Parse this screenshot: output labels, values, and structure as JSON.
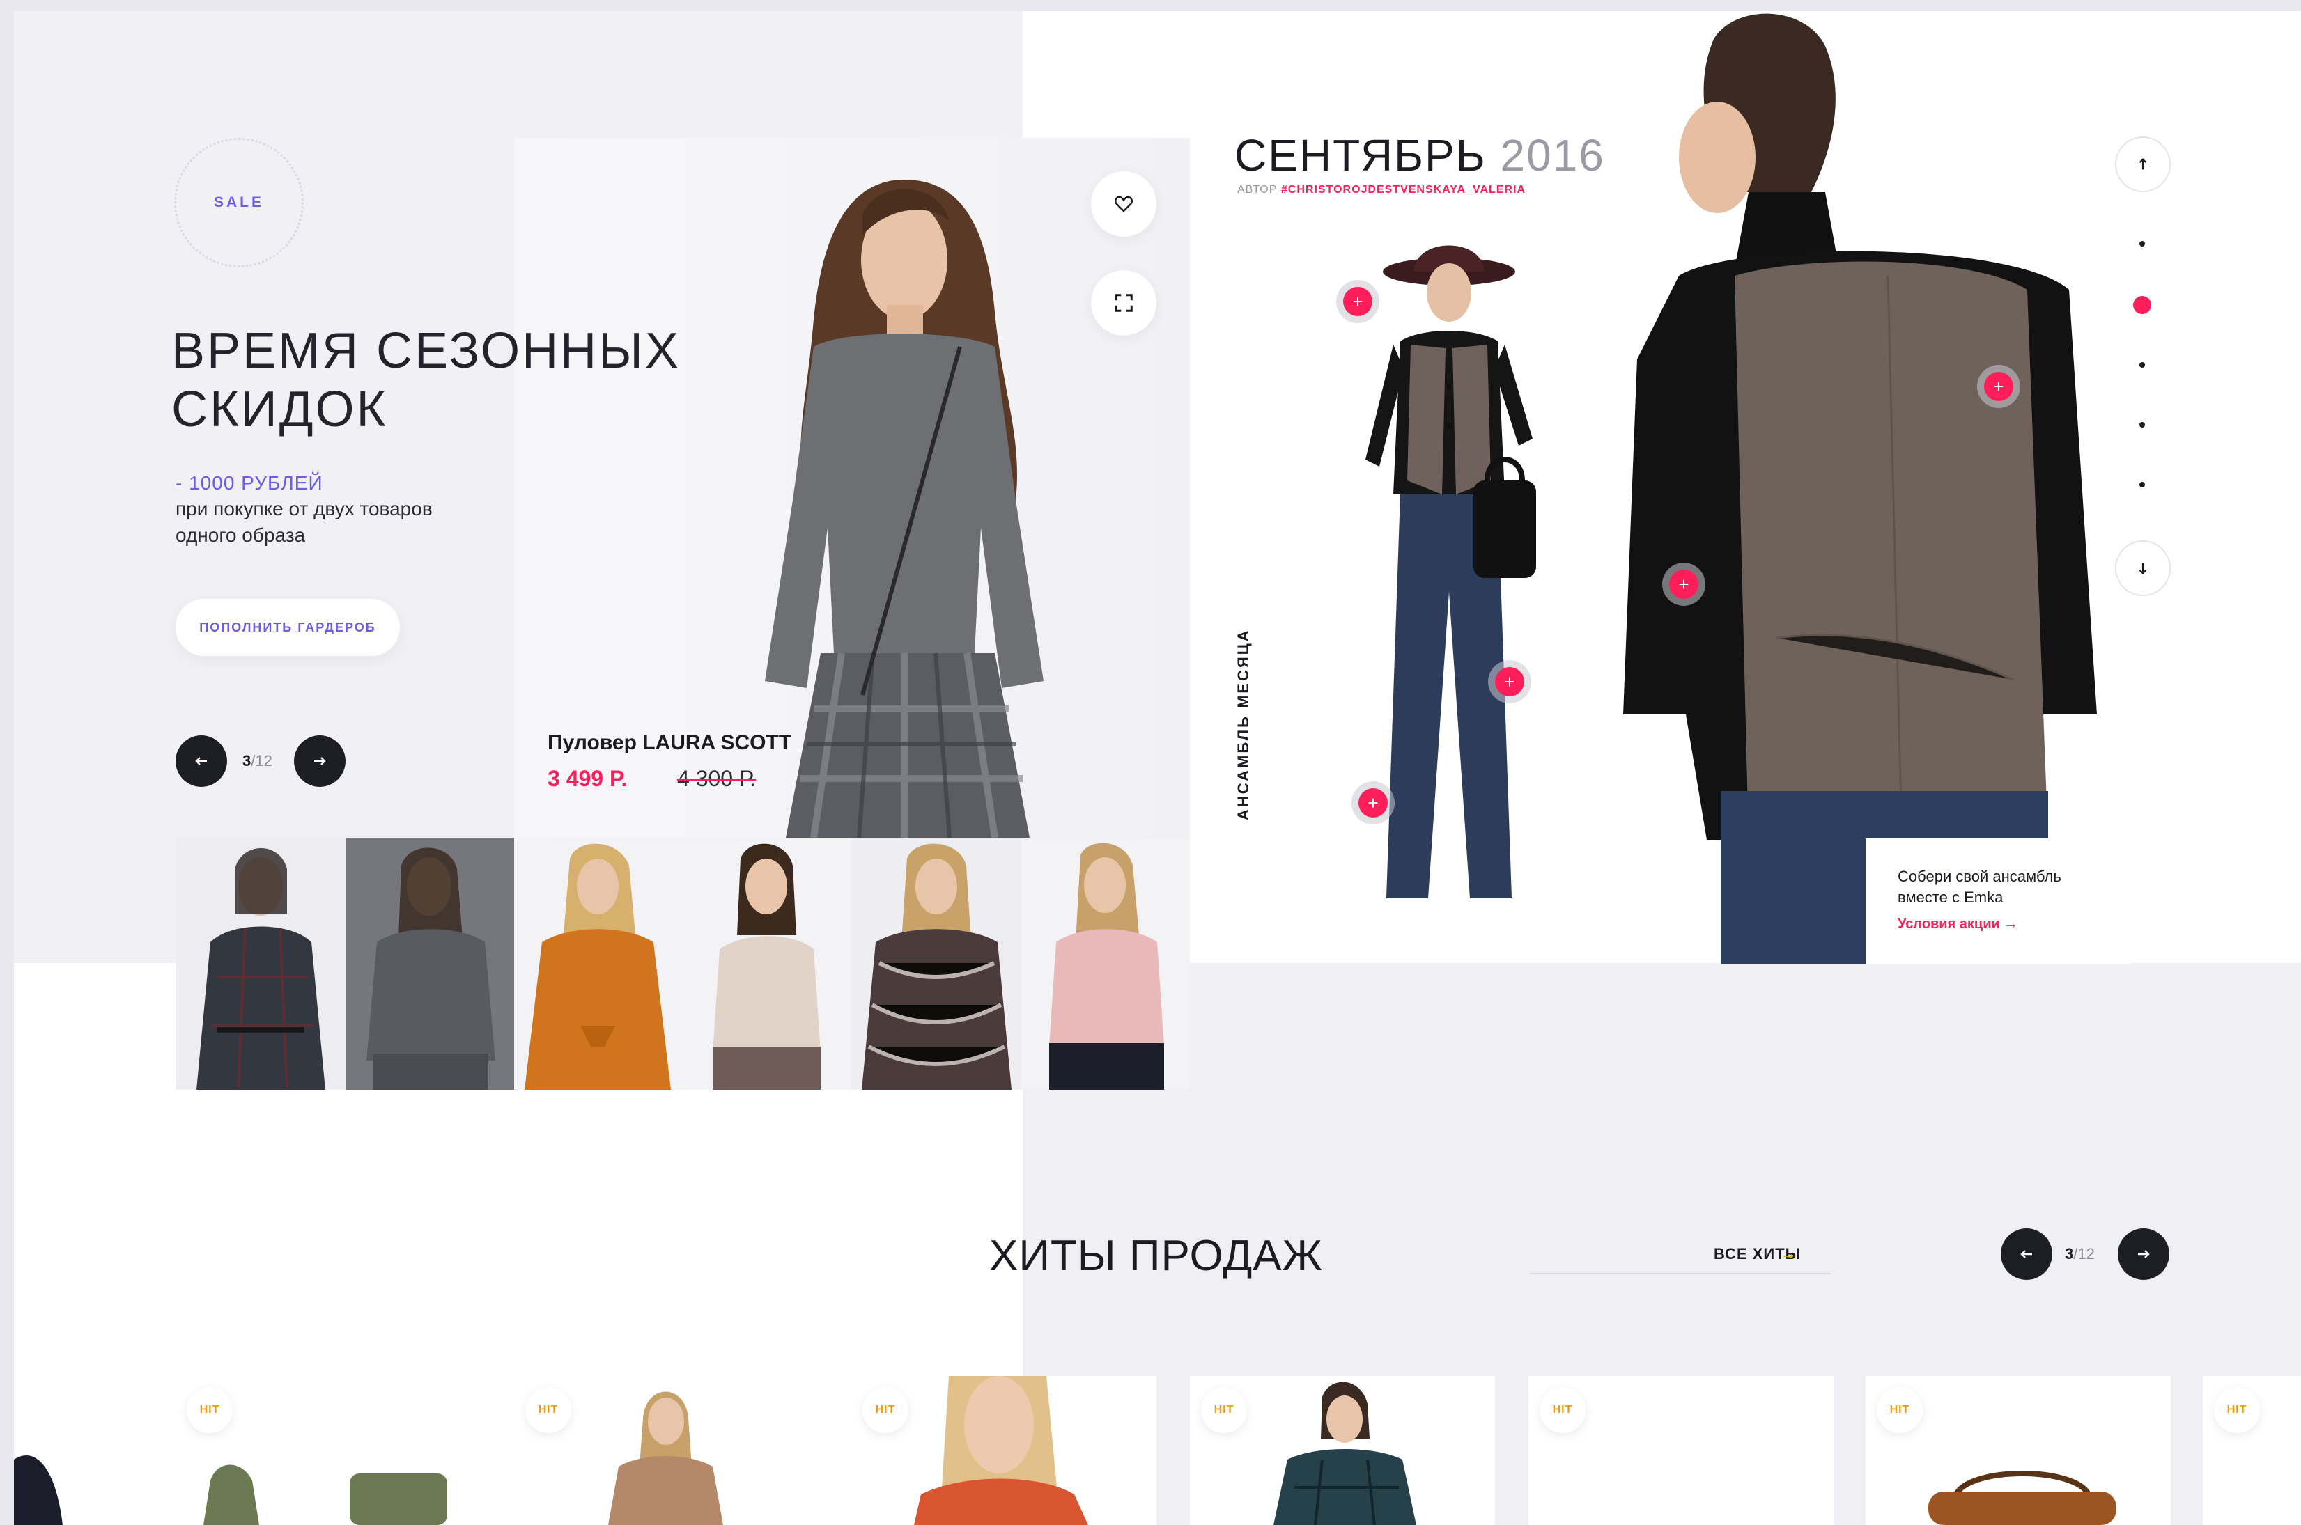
{
  "hero": {
    "badge": "SALE",
    "title_line1": "ВРЕМЯ СЕЗОННЫХ",
    "title_line2": "СКИДОК",
    "discount": "- 1000 РУБЛЕЙ",
    "discount_desc_line1": "при покупке от двух товаров",
    "discount_desc_line2": "одного образа",
    "cta": "ПОПОЛНИТЬ ГАРДЕРОБ",
    "pager_current": "3",
    "pager_total": "/12",
    "product_name": "Пуловер LAURA SCOTT",
    "product_price": "3 499 Р.",
    "product_old_price": "4 300 Р."
  },
  "ensemble": {
    "title": "СЕНТЯБРЬ",
    "year": "2016",
    "author_label": "АВТОР",
    "author_tag": "#CHRISTOROJDESTVENSKAYA_VALERIA",
    "vertical_label": "АНСАМБЛЬ МЕСЯЦА",
    "promo_line1": "Собери свой ансамбль",
    "promo_line2": "вместе с Emka",
    "promo_link": "Условия акции",
    "active_dot_index": 1
  },
  "hits": {
    "title": "ХИТЫ ПРОДАЖ",
    "all_link": "ВСЕ ХИТЫ",
    "pager_current": "3",
    "pager_total": "/12",
    "badge": "HIT"
  },
  "colors": {
    "accent_pink": "#ff1e5a",
    "accent_purple": "#6c5ce7",
    "accent_orange": "#f39c12",
    "dark": "#1d1e24"
  }
}
